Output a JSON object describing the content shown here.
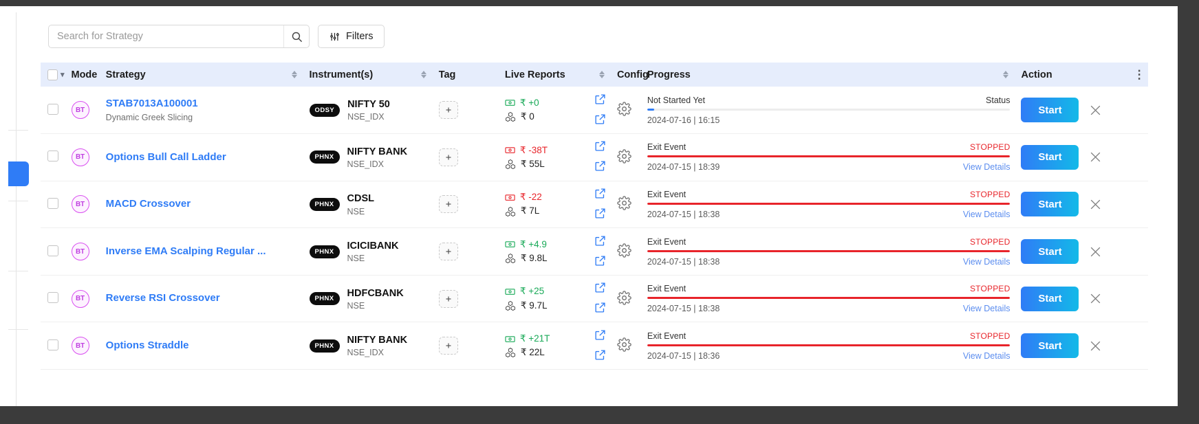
{
  "search": {
    "placeholder": "Search for Strategy",
    "value": "",
    "icon": "search-icon"
  },
  "toolbar": {
    "filters_label": "Filters",
    "filters_icon": "filters-sliders-icon"
  },
  "table": {
    "headers": {
      "mode": "Mode",
      "strategy": "Strategy",
      "instruments": "Instrument(s)",
      "tag": "Tag",
      "live_reports": "Live Reports",
      "config": "Config",
      "progress": "Progress",
      "action": "Action"
    },
    "rows": [
      {
        "mode": "BT",
        "strategy_name": "STAB7013A100001",
        "strategy_sub": "Dynamic Greek Slicing",
        "inst_pill": "ODSY",
        "inst_name": "NIFTY 50",
        "inst_exchange": "NSE_IDX",
        "pnl": "₹ +0",
        "pnl_sign": "positive",
        "margin": "₹ 0",
        "progress_label": "Not Started Yet",
        "progress_status": "Status",
        "progress_status_kind": "plain",
        "progress_pct": 2,
        "progress_color": "#2f7cf6",
        "date": "2024-07-16 | 16:15",
        "details_label": "",
        "action_label": "Start"
      },
      {
        "mode": "BT",
        "strategy_name": "Options Bull Call Ladder",
        "strategy_sub": "",
        "inst_pill": "PHNX",
        "inst_name": "NIFTY BANK",
        "inst_exchange": "NSE_IDX",
        "pnl": "₹ -38T",
        "pnl_sign": "negative",
        "margin": "₹ 55L",
        "progress_label": "Exit Event",
        "progress_status": "STOPPED",
        "progress_status_kind": "stopped",
        "progress_pct": 100,
        "progress_color": "#e8242a",
        "date": "2024-07-15 | 18:39",
        "details_label": "View Details",
        "action_label": "Start"
      },
      {
        "mode": "BT",
        "strategy_name": "MACD Crossover",
        "strategy_sub": "",
        "inst_pill": "PHNX",
        "inst_name": "CDSL",
        "inst_exchange": "NSE",
        "pnl": "₹ -22",
        "pnl_sign": "negative",
        "margin": "₹ 7L",
        "progress_label": "Exit Event",
        "progress_status": "STOPPED",
        "progress_status_kind": "stopped",
        "progress_pct": 100,
        "progress_color": "#e8242a",
        "date": "2024-07-15 | 18:38",
        "details_label": "View Details",
        "action_label": "Start"
      },
      {
        "mode": "BT",
        "strategy_name": "Inverse EMA Scalping Regular ...",
        "strategy_sub": "",
        "inst_pill": "PHNX",
        "inst_name": "ICICIBANK",
        "inst_exchange": "NSE",
        "pnl": "₹ +4.9",
        "pnl_sign": "positive",
        "margin": "₹ 9.8L",
        "progress_label": "Exit Event",
        "progress_status": "STOPPED",
        "progress_status_kind": "stopped",
        "progress_pct": 100,
        "progress_color": "#e8242a",
        "date": "2024-07-15 | 18:38",
        "details_label": "View Details",
        "action_label": "Start"
      },
      {
        "mode": "BT",
        "strategy_name": "Reverse RSI Crossover",
        "strategy_sub": "",
        "inst_pill": "PHNX",
        "inst_name": "HDFCBANK",
        "inst_exchange": "NSE",
        "pnl": "₹ +25",
        "pnl_sign": "positive",
        "margin": "₹ 9.7L",
        "progress_label": "Exit Event",
        "progress_status": "STOPPED",
        "progress_status_kind": "stopped",
        "progress_pct": 100,
        "progress_color": "#e8242a",
        "date": "2024-07-15 | 18:38",
        "details_label": "View Details",
        "action_label": "Start"
      },
      {
        "mode": "BT",
        "strategy_name": "Options Straddle",
        "strategy_sub": "",
        "inst_pill": "PHNX",
        "inst_name": "NIFTY BANK",
        "inst_exchange": "NSE_IDX",
        "pnl": "₹ +21T",
        "pnl_sign": "positive",
        "margin": "₹ 22L",
        "progress_label": "Exit Event",
        "progress_status": "STOPPED",
        "progress_status_kind": "stopped",
        "progress_pct": 100,
        "progress_color": "#e8242a",
        "date": "2024-07-15 | 18:36",
        "details_label": "View Details",
        "action_label": "Start"
      }
    ]
  },
  "colors": {
    "accent_blue": "#2f7cf6",
    "accent_cyan": "#13b9e8",
    "header_bg": "#e6edfc",
    "positive": "#18a957",
    "negative": "#e8242a",
    "mode_badge": "#c03fe0"
  }
}
